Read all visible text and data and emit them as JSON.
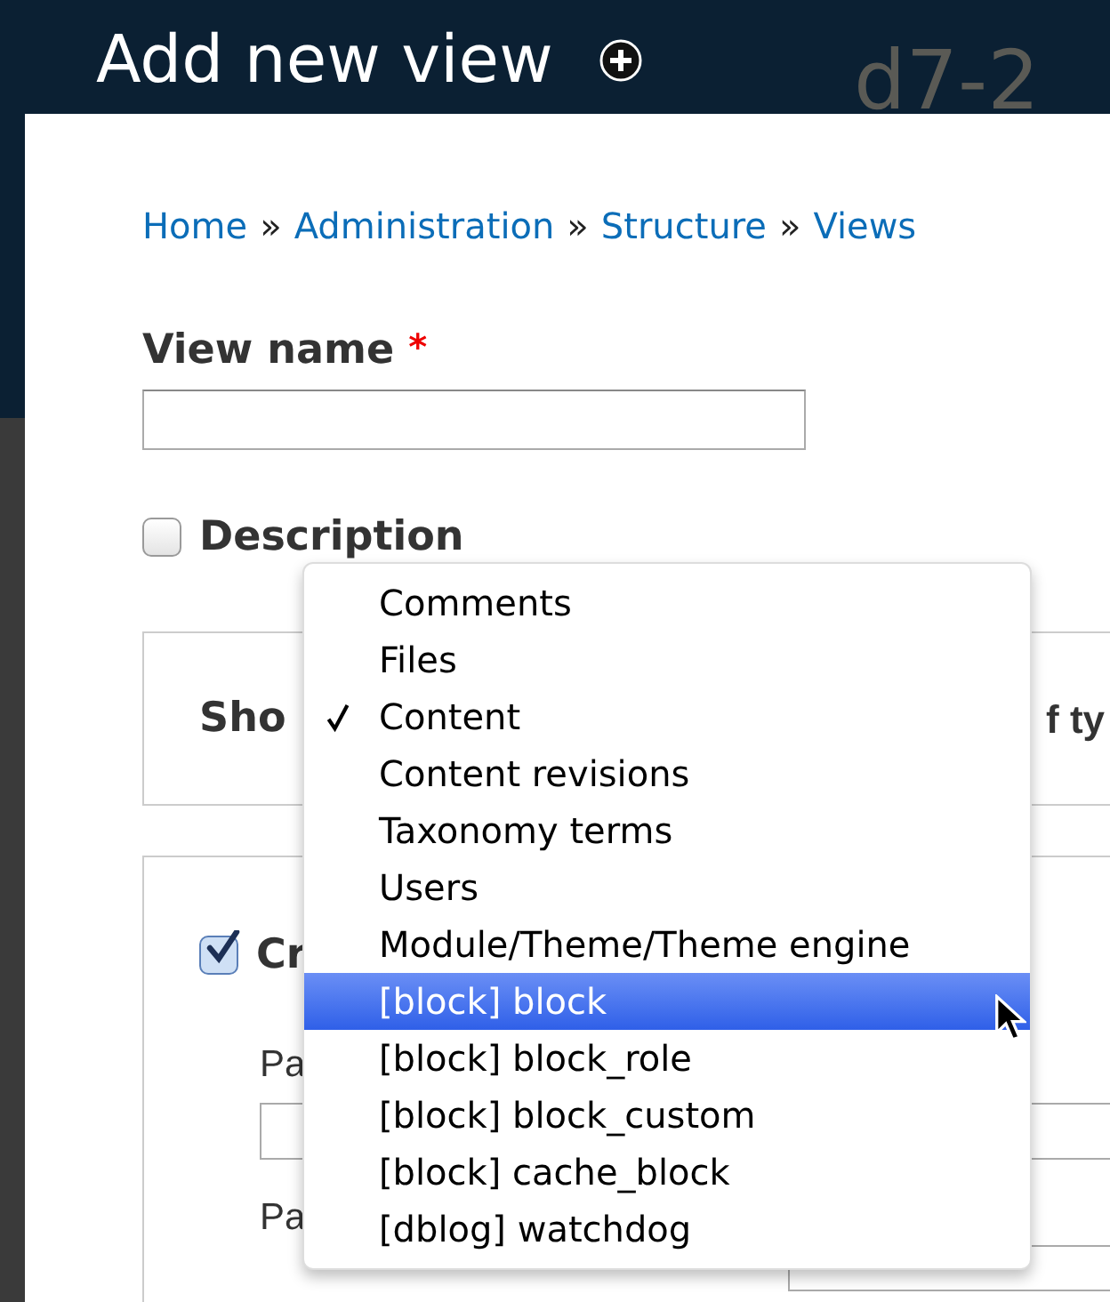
{
  "header": {
    "title": "Add new view",
    "site_name": "d7-2"
  },
  "breadcrumb": {
    "separator": "»",
    "links": [
      "Home",
      "Administration",
      "Structure",
      "Views"
    ]
  },
  "view_name": {
    "label": "View name",
    "required_mark": "*"
  },
  "description": {
    "label": "Description",
    "checked": false
  },
  "show_fieldset": {
    "label": "Sho",
    "suffix": "f ty"
  },
  "page_fieldset": {
    "create_page": {
      "label": "Cr",
      "checked": true
    },
    "page_title_label": "Pa",
    "path_label": "Pa"
  },
  "dropdown": {
    "items": [
      {
        "label": "Comments",
        "checked": false,
        "highlighted": false
      },
      {
        "label": "Files",
        "checked": false,
        "highlighted": false
      },
      {
        "label": "Content",
        "checked": true,
        "highlighted": false
      },
      {
        "label": "Content revisions",
        "checked": false,
        "highlighted": false
      },
      {
        "label": "Taxonomy terms",
        "checked": false,
        "highlighted": false
      },
      {
        "label": "Users",
        "checked": false,
        "highlighted": false
      },
      {
        "label": "Module/Theme/Theme engine",
        "checked": false,
        "highlighted": false
      },
      {
        "label": "[block] block",
        "checked": false,
        "highlighted": true
      },
      {
        "label": "[block] block_role",
        "checked": false,
        "highlighted": false
      },
      {
        "label": "[block] block_custom",
        "checked": false,
        "highlighted": false
      },
      {
        "label": "[block] cache_block",
        "checked": false,
        "highlighted": false
      },
      {
        "label": "[dblog] watchdog",
        "checked": false,
        "highlighted": false
      }
    ]
  }
}
